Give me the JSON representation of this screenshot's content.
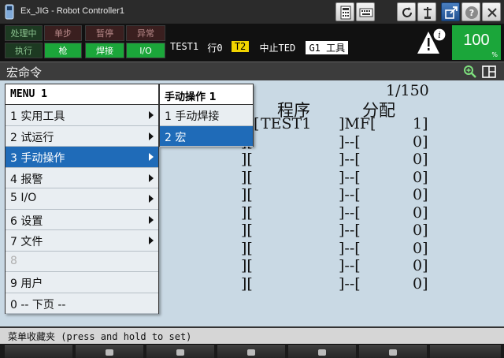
{
  "window": {
    "title": "Ex_JIG - Robot Controller1"
  },
  "titlebar_icons": [
    "keypad-icon",
    "keyboard-icon",
    "refresh-icon",
    "robot-icon",
    "external-icon",
    "help-icon",
    "close-icon"
  ],
  "status": {
    "buttons_row1": [
      "处理中",
      "单步",
      "暂停",
      "异常"
    ],
    "buttons_row2": [
      "执行",
      "枪",
      "焊接",
      "I/O"
    ],
    "program": "TEST1",
    "line": "行0",
    "task_tag": "T2",
    "state": "中止TED",
    "tool_tag": "G1 工具",
    "speed": "100",
    "speed_unit": "%"
  },
  "screen": {
    "title": "宏命令"
  },
  "table": {
    "page_info": "1/150",
    "headers": {
      "program": "程序",
      "assign": "分配"
    },
    "rows": [
      {
        "prefix": "[",
        "name": "TEST1",
        "assign": "]MF[",
        "num": "1]"
      },
      {
        "prefix": "][",
        "name": "",
        "assign": "]--[",
        "num": "0]"
      },
      {
        "prefix": "][",
        "name": "",
        "assign": "]--[",
        "num": "0]"
      },
      {
        "prefix": "][",
        "name": "",
        "assign": "]--[",
        "num": "0]"
      },
      {
        "prefix": "][",
        "name": "",
        "assign": "]--[",
        "num": "0]"
      },
      {
        "prefix": "][",
        "name": "",
        "assign": "]--[",
        "num": "0]"
      },
      {
        "prefix": "][",
        "name": "",
        "assign": "]--[",
        "num": "0]"
      },
      {
        "prefix": "][",
        "name": "",
        "assign": "]--[",
        "num": "0]"
      },
      {
        "prefix": "][",
        "name": "",
        "assign": "]--[",
        "num": "0]"
      },
      {
        "prefix": "][",
        "name": "",
        "assign": "]--[",
        "num": "0]"
      }
    ]
  },
  "menu": {
    "header": "MENU  1",
    "items": [
      {
        "label": "1 实用工具",
        "submenu": true,
        "selected": false,
        "disabled": false
      },
      {
        "label": "2 试运行",
        "submenu": true,
        "selected": false,
        "disabled": false
      },
      {
        "label": "3 手动操作",
        "submenu": true,
        "selected": true,
        "disabled": false
      },
      {
        "label": "4 报警",
        "submenu": true,
        "selected": false,
        "disabled": false
      },
      {
        "label": "5 I/O",
        "submenu": true,
        "selected": false,
        "disabled": false
      },
      {
        "label": "6 设置",
        "submenu": true,
        "selected": false,
        "disabled": false
      },
      {
        "label": "7 文件",
        "submenu": true,
        "selected": false,
        "disabled": false
      },
      {
        "label": "8",
        "submenu": false,
        "selected": false,
        "disabled": true
      },
      {
        "label": "9 用户",
        "submenu": false,
        "selected": false,
        "disabled": false
      },
      {
        "label": "0 -- 下页 --",
        "submenu": false,
        "selected": false,
        "disabled": false
      }
    ]
  },
  "submenu": {
    "header": "手动操作   1",
    "items": [
      {
        "label": "1 手动焊接",
        "selected": false
      },
      {
        "label": "2 宏",
        "selected": true
      }
    ]
  },
  "prompt": "菜单收藏夹 (press and hold to set)",
  "colors": {
    "selected": "#1f6bb8",
    "main_bg": "#c9d9e4",
    "status_green": "#1ba63a",
    "task_yellow": "#f2d400"
  }
}
